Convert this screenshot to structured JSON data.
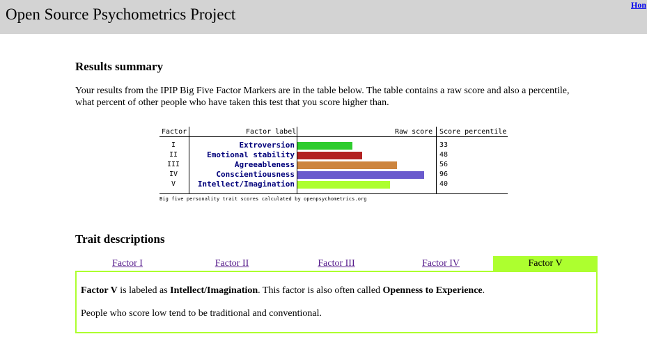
{
  "header": {
    "site_title": "Open Source Psychometrics Project",
    "home_link": "Hon"
  },
  "results": {
    "heading": "Results summary",
    "intro": "Your results from the IPIP Big Five Factor Markers are in the table below. The table contains a raw score and also a percentile, what percent of other people who have taken this test that you score higher than."
  },
  "score_table": {
    "headers": {
      "factor": "Factor",
      "label": "Factor label",
      "raw": "Raw score",
      "percentile": "Score percentile"
    },
    "rows": [
      {
        "roman": "I",
        "label": "Extroversion",
        "raw_fraction": 0.4,
        "percentile": "33",
        "color": "#2ecc2e"
      },
      {
        "roman": "II",
        "label": "Emotional stability",
        "raw_fraction": 0.47,
        "percentile": "48",
        "color": "#b22222"
      },
      {
        "roman": "III",
        "label": "Agreeableness",
        "raw_fraction": 0.72,
        "percentile": "56",
        "color": "#cd853f"
      },
      {
        "roman": "IV",
        "label": "Conscientiousness",
        "raw_fraction": 0.92,
        "percentile": "96",
        "color": "#6a5acd"
      },
      {
        "roman": "V",
        "label": "Intellect/Imagination",
        "raw_fraction": 0.67,
        "percentile": "40",
        "color": "#adff2f"
      }
    ],
    "caption": "Big five personality trait scores calculated by openpsychometrics.org"
  },
  "traits": {
    "heading": "Trait descriptions",
    "tabs": [
      "Factor I",
      "Factor II",
      "Factor III",
      "Factor IV",
      "Factor V"
    ],
    "active_tab": 4,
    "panel": {
      "factor_name": "Factor V",
      "text1": " is labeled as ",
      "trait_label": "Intellect/Imagination",
      "text2": ". This factor is also often called ",
      "alt_name": "Openness to Experience",
      "text3": ".",
      "low_score_text": "People who score low tend to be traditional and conventional."
    }
  },
  "colors": {
    "header_bg": "#d3d3d3",
    "accent": "#adff2f",
    "label_text": "#00007a"
  }
}
